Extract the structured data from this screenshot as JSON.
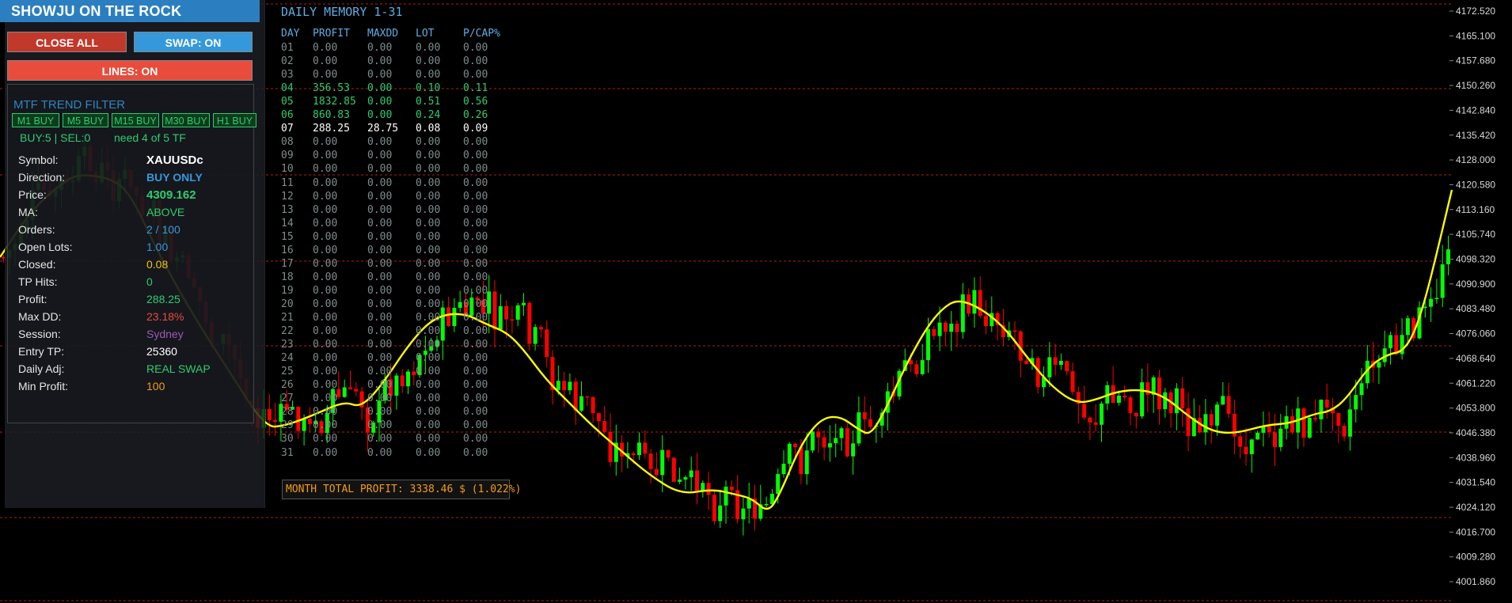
{
  "panel": {
    "title": "SHOWJU ON THE ROCK",
    "close_all_label": "CLOSE ALL",
    "swap_label": "SWAP: ON",
    "lines_label": "LINES: ON",
    "mtf_title": "MTF TREND FILTER",
    "tf_buttons": [
      "M1 BUY",
      "M5 BUY",
      "M15 BUY",
      "M30 BUY",
      "H1 BUY"
    ],
    "buysel": "BUY:5 | SEL:0",
    "need": "need 4 of 5 TF",
    "info": [
      {
        "label": "Symbol:",
        "value": "XAUUSDc",
        "color": "#ffffff"
      },
      {
        "label": "Direction:",
        "value": "BUY ONLY",
        "color": "#3498db"
      },
      {
        "label": "Price:",
        "value": "4309.162",
        "color": "#2ecc71"
      },
      {
        "label": "MA:",
        "value": "ABOVE",
        "color": "#2ecc71"
      },
      {
        "label": "Orders:",
        "value": "2 / 100",
        "color": "#3498db"
      },
      {
        "label": "Open Lots:",
        "value": "1.00",
        "color": "#3498db"
      },
      {
        "label": "Closed:",
        "value": "0.08",
        "color": "#f1c40f"
      },
      {
        "label": "TP Hits:",
        "value": "0",
        "color": "#2ecc71"
      },
      {
        "label": "Profit:",
        "value": "288.25",
        "color": "#2ecc71"
      },
      {
        "label": "Max DD:",
        "value": "23.18%",
        "color": "#e74c3c"
      },
      {
        "label": "Session:",
        "value": "Sydney",
        "color": "#9b59b6"
      },
      {
        "label": "Entry TP:",
        "value": "25360",
        "color": "#ffffff"
      },
      {
        "label": "Daily Adj:",
        "value": "REAL SWAP",
        "color": "#2ecc71"
      },
      {
        "label": "Min Profit:",
        "value": "100",
        "color": "#f39c12"
      }
    ]
  },
  "daily_memory": {
    "title": "DAILY MEMORY 1-31",
    "headers": [
      "DAY",
      "PROFIT",
      "MAXDD",
      "LOT",
      "P/CAP%"
    ],
    "rows": [
      {
        "cells": [
          "01",
          "0.00",
          "0.00",
          "0.00",
          "0.00"
        ],
        "color": "#7f8c8d"
      },
      {
        "cells": [
          "02",
          "0.00",
          "0.00",
          "0.00",
          "0.00"
        ],
        "color": "#7f8c8d"
      },
      {
        "cells": [
          "03",
          "0.00",
          "0.00",
          "0.00",
          "0.00"
        ],
        "color": "#7f8c8d"
      },
      {
        "cells": [
          "04",
          "356.53",
          "0.00",
          "0.10",
          "0.11"
        ],
        "color": "#2ecc71"
      },
      {
        "cells": [
          "05",
          "1832.85",
          "0.00",
          "0.51",
          "0.56"
        ],
        "color": "#2ecc71"
      },
      {
        "cells": [
          "06",
          "860.83",
          "0.00",
          "0.24",
          "0.26"
        ],
        "color": "#2ecc71"
      },
      {
        "cells": [
          "07",
          "288.25",
          "28.75",
          "0.08",
          "0.09"
        ],
        "color": "#ffffff"
      },
      {
        "cells": [
          "08",
          "0.00",
          "0.00",
          "0.00",
          "0.00"
        ],
        "color": "#7f8c8d"
      },
      {
        "cells": [
          "09",
          "0.00",
          "0.00",
          "0.00",
          "0.00"
        ],
        "color": "#7f8c8d"
      },
      {
        "cells": [
          "10",
          "0.00",
          "0.00",
          "0.00",
          "0.00"
        ],
        "color": "#7f8c8d"
      },
      {
        "cells": [
          "11",
          "0.00",
          "0.00",
          "0.00",
          "0.00"
        ],
        "color": "#7f8c8d"
      },
      {
        "cells": [
          "12",
          "0.00",
          "0.00",
          "0.00",
          "0.00"
        ],
        "color": "#7f8c8d"
      },
      {
        "cells": [
          "13",
          "0.00",
          "0.00",
          "0.00",
          "0.00"
        ],
        "color": "#7f8c8d"
      },
      {
        "cells": [
          "14",
          "0.00",
          "0.00",
          "0.00",
          "0.00"
        ],
        "color": "#7f8c8d"
      },
      {
        "cells": [
          "15",
          "0.00",
          "0.00",
          "0.00",
          "0.00"
        ],
        "color": "#7f8c8d"
      },
      {
        "cells": [
          "16",
          "0.00",
          "0.00",
          "0.00",
          "0.00"
        ],
        "color": "#7f8c8d"
      },
      {
        "cells": [
          "17",
          "0.00",
          "0.00",
          "0.00",
          "0.00"
        ],
        "color": "#7f8c8d"
      },
      {
        "cells": [
          "18",
          "0.00",
          "0.00",
          "0.00",
          "0.00"
        ],
        "color": "#7f8c8d"
      },
      {
        "cells": [
          "19",
          "0.00",
          "0.00",
          "0.00",
          "0.00"
        ],
        "color": "#7f8c8d"
      },
      {
        "cells": [
          "20",
          "0.00",
          "0.00",
          "0.00",
          "0.00"
        ],
        "color": "#7f8c8d"
      },
      {
        "cells": [
          "21",
          "0.00",
          "0.00",
          "0.00",
          "0.00"
        ],
        "color": "#7f8c8d"
      },
      {
        "cells": [
          "22",
          "0.00",
          "0.00",
          "0.00",
          "0.00"
        ],
        "color": "#7f8c8d"
      },
      {
        "cells": [
          "23",
          "0.00",
          "0.00",
          "0.00",
          "0.00"
        ],
        "color": "#7f8c8d"
      },
      {
        "cells": [
          "24",
          "0.00",
          "0.00",
          "0.00",
          "0.00"
        ],
        "color": "#7f8c8d"
      },
      {
        "cells": [
          "25",
          "0.00",
          "0.00",
          "0.00",
          "0.00"
        ],
        "color": "#7f8c8d"
      },
      {
        "cells": [
          "26",
          "0.00",
          "0.00",
          "0.00",
          "0.00"
        ],
        "color": "#7f8c8d"
      },
      {
        "cells": [
          "27",
          "0.00",
          "0.00",
          "0.00",
          "0.00"
        ],
        "color": "#7f8c8d"
      },
      {
        "cells": [
          "28",
          "0.00",
          "0.00",
          "0.00",
          "0.00"
        ],
        "color": "#7f8c8d"
      },
      {
        "cells": [
          "29",
          "0.00",
          "0.00",
          "0.00",
          "0.00"
        ],
        "color": "#7f8c8d"
      },
      {
        "cells": [
          "30",
          "0.00",
          "0.00",
          "0.00",
          "0.00"
        ],
        "color": "#7f8c8d"
      },
      {
        "cells": [
          "31",
          "0.00",
          "0.00",
          "0.00",
          "0.00"
        ],
        "color": "#7f8c8d"
      }
    ],
    "total": "MONTH TOTAL PROFIT: 3338.46 $ (1.022%)"
  },
  "chart": {
    "price_labels": [
      "4172.520",
      "4165.100",
      "4157.680",
      "4150.260",
      "4142.840",
      "4135.420",
      "4128.000",
      "4120.580",
      "4113.160",
      "4105.740",
      "4098.320",
      "4090.900",
      "4083.480",
      "4076.060",
      "4068.640",
      "4061.220",
      "4053.800",
      "4046.380",
      "4038.960",
      "4031.540",
      "4024.120",
      "4016.700",
      "4009.280",
      "4001.860"
    ],
    "colors": {
      "up": "#00ff00",
      "down": "#ff0000",
      "ma": "#ffff00",
      "levels": "#b31b1b",
      "axis_text": "#d8d8d8"
    }
  }
}
